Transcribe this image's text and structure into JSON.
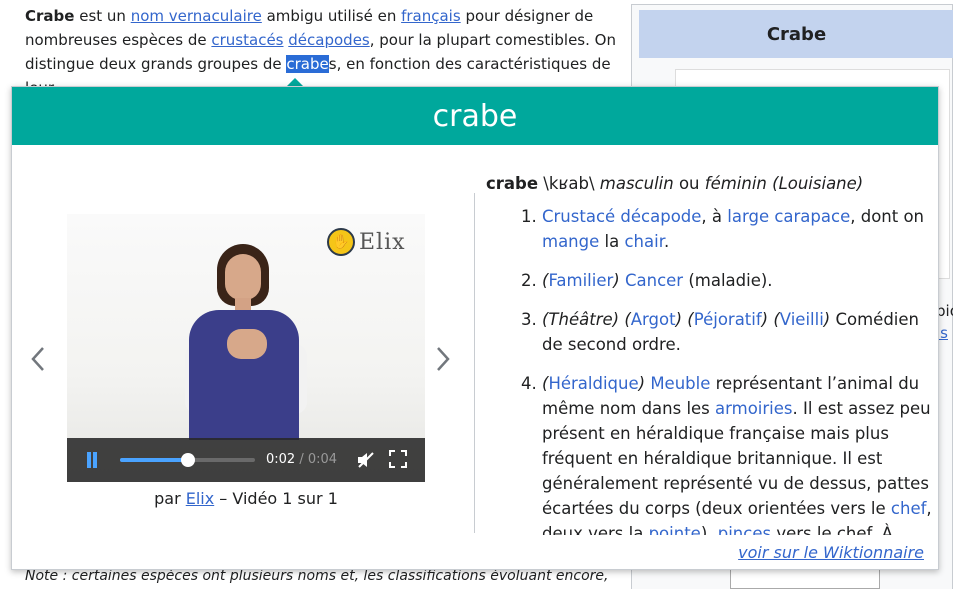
{
  "article": {
    "l1_title": "Crabe",
    "l1_a": " est un ",
    "l1_link1": "nom vernaculaire",
    "l1_b": " ambigu utilisé en ",
    "l1_link2": "français",
    "l1_c": " pour désigner de",
    "l2_a": "nombreuses espèces de ",
    "l2_link1": "crustacés",
    "l2_link2": "décapodes",
    "l2_b": ", pour la plupart comestibles. On",
    "l3_a": "distingue deux grands groupes de ",
    "l3_hl": "crabe",
    "l3_rest": "s",
    "l3_b": ", en fonction des caractéristiques de leur",
    "note": "Note : certaines espèces ont plusieurs noms et, les classifications évoluant encore,"
  },
  "infobox": {
    "title": "Crabe",
    "side_1": "bio",
    "side_2": "is"
  },
  "popup": {
    "title": "crabe",
    "prev_icon": "chevron-left-icon",
    "next_icon": "chevron-right-icon",
    "video": {
      "logo": "Elix",
      "time_current": "0:02",
      "time_sep": " / ",
      "time_total": "0:04",
      "progress": 0.5,
      "caption_prefix": "par ",
      "caption_link": "Elix",
      "caption_suffix": " – Vidéo 1 sur 1"
    },
    "definition": {
      "word": "crabe",
      "pron": " \\kʁab\\ ",
      "gender1": "masculin",
      "or": " ou ",
      "gender2": "féminin (Louisiane)",
      "items": [
        {
          "l1": "Crustacé décapode",
          "t1": ", à ",
          "l2": "large carapace",
          "t2": ", dont on ",
          "l3": "mange",
          "t3": " la ",
          "l4": "chair",
          "t4": "."
        },
        {
          "p1": "(",
          "l1": "Familier",
          "p2": ") ",
          "l2": "Cancer",
          "t1": " (maladie)."
        },
        {
          "p1": "(Théâtre) (",
          "l1": "Argot",
          "p2": ") (",
          "l2": "Péjoratif",
          "p3": ") (",
          "l3": "Vieilli",
          "p4": ")",
          "t1": " Comédien de second ordre."
        },
        {
          "p1": "(",
          "l1": "Héraldique",
          "p2": ") ",
          "l2": "Meuble",
          "t1": " représentant l’animal du même nom dans les ",
          "l3": "armoiries",
          "t2": ". Il est assez peu présent en héraldique française mais plus fréquent en héraldique britannique. Il est généralement représenté vu de dessus, pattes écartées du corps (deux orientées vers le ",
          "l4": "chef",
          "t3": ", deux vers la ",
          "l5": "pointe",
          "t4": "), ",
          "l6": "pinces",
          "t5": " vers le chef. À"
        }
      ]
    },
    "footer_link": "voir sur le Wiktionnaire"
  },
  "colors": {
    "header": "#00a89c",
    "link": "#3366cc",
    "highlight": "#2a6cd6",
    "infobox_title": "#c3d3ee"
  }
}
